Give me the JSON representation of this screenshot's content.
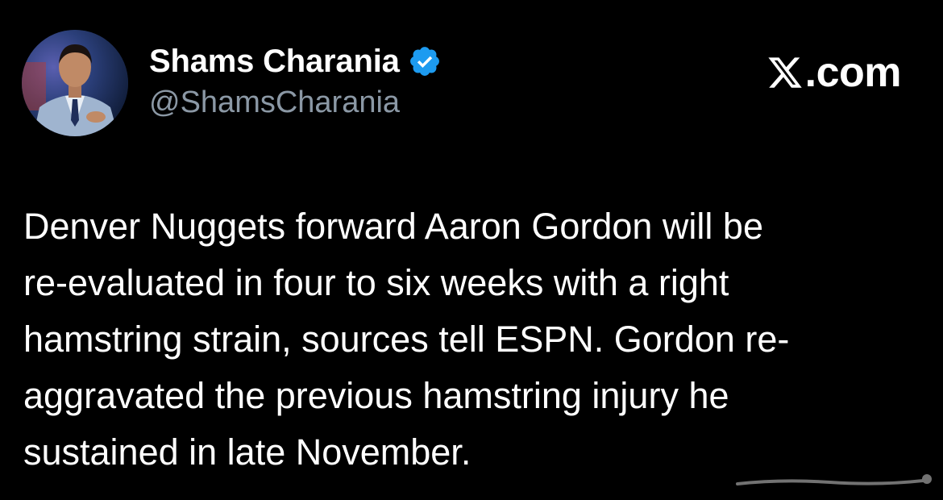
{
  "author": {
    "display_name": "Shams Charania",
    "handle": "@ShamsCharania",
    "verified": true,
    "verified_color": "#1d9bf0",
    "avatar_icon": "profile-photo"
  },
  "brand": {
    "icon": "x-logo-icon",
    "text": ".com"
  },
  "tweet": {
    "lines": [
      "Denver Nuggets forward Aaron Gordon will be",
      "re-evaluated in four to six weeks with a right",
      "hamstring strain, sources tell ESPN. Gordon re-",
      "aggravated the previous hamstring injury he",
      "sustained in late November."
    ]
  },
  "colors": {
    "background": "#000000",
    "text": "#ffffff",
    "handle": "#8b98a5"
  }
}
